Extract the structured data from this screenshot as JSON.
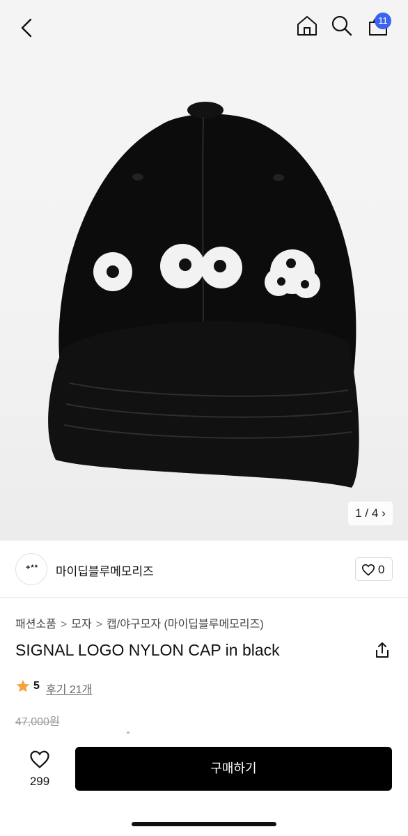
{
  "header": {
    "cart_count": "11",
    "icons": [
      "chevron-left-icon",
      "home-icon",
      "search-icon",
      "cart-icon"
    ],
    "badge_color": "#3b63f0"
  },
  "gallery": {
    "pager": "1 / 4",
    "pager_icon": "chevron-right-icon"
  },
  "brand": {
    "logo_text": "+**",
    "name": "마이딥블루메모리즈",
    "like_count": "0"
  },
  "breadcrumb": {
    "items": [
      "패션소품",
      "모자",
      "캡/야구모자 (마이딥블루메모리즈)"
    ],
    "separator": ">"
  },
  "product": {
    "title": "SIGNAL LOGO NYLON CAP in black",
    "rating_score": "5",
    "reviews": "후기 21개",
    "original_price": "47,000원",
    "star_color": "#f2a33a"
  },
  "footer": {
    "wish_count": "299",
    "buy_label": "구매하기"
  }
}
